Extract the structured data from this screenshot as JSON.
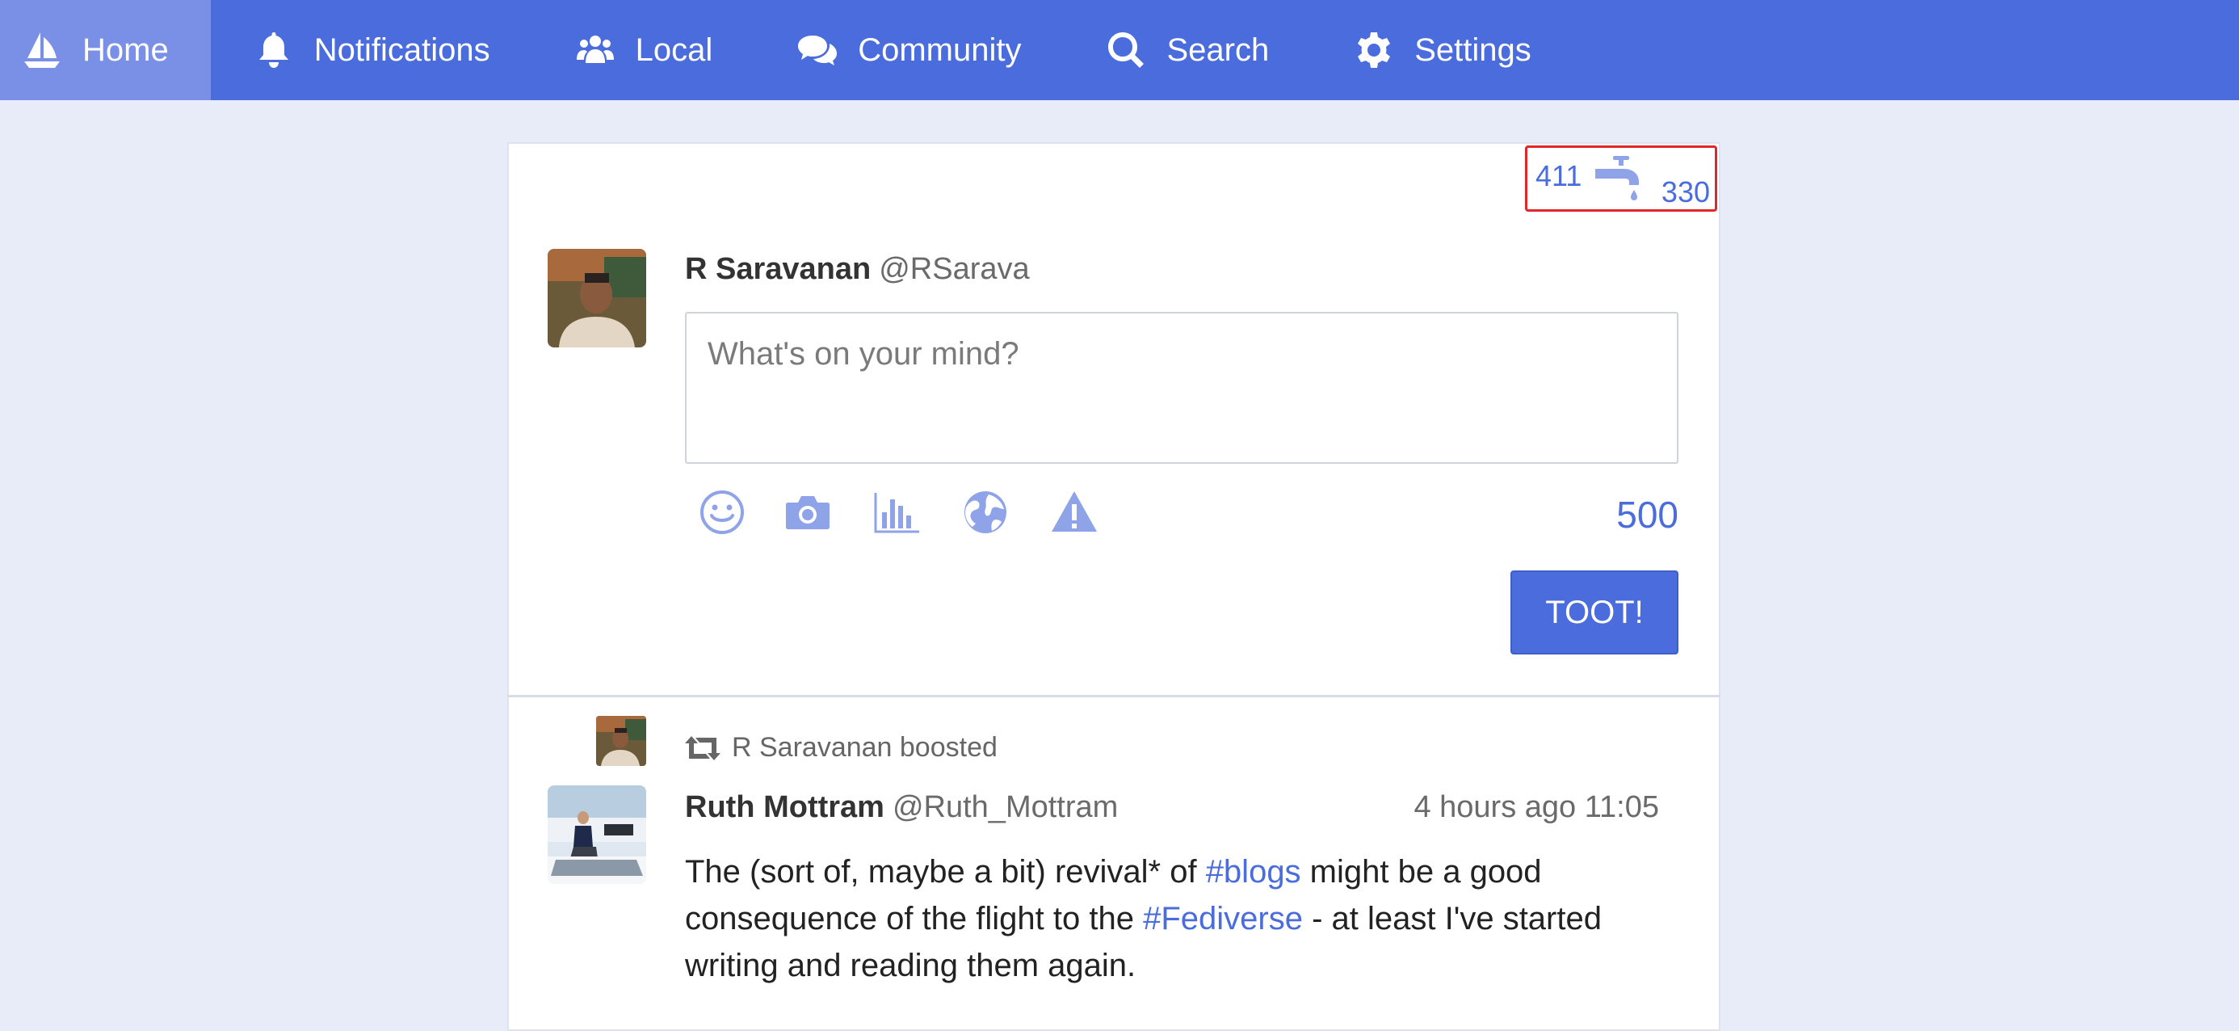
{
  "nav": {
    "items": [
      {
        "label": "Home",
        "icon": "sailboat-icon",
        "active": true
      },
      {
        "label": "Notifications",
        "icon": "bell-icon"
      },
      {
        "label": "Local",
        "icon": "users-icon"
      },
      {
        "label": "Community",
        "icon": "comments-icon"
      },
      {
        "label": "Search",
        "icon": "search-icon"
      },
      {
        "label": "Settings",
        "icon": "gear-icon"
      }
    ]
  },
  "counters": {
    "left": "411",
    "right": "330",
    "icon": "faucet-icon"
  },
  "composer": {
    "name": "R Saravanan",
    "handle": "@RSarava",
    "placeholder": "What's on your mind?",
    "char_count": "500",
    "submit_label": "TOOT!",
    "tools": [
      "smile-icon",
      "camera-icon",
      "poll-icon",
      "globe-icon",
      "warning-icon"
    ]
  },
  "status": {
    "boosted_by": "R Saravanan boosted",
    "author_name": "Ruth Mottram",
    "author_handle": "@Ruth_Mottram",
    "time": "4 hours ago 11:05",
    "body": {
      "part1": "The (sort of, maybe a bit) revival* of ",
      "tag1": "#blogs",
      "part2": " might be a good consequence of the flight to the ",
      "tag2": "#Fediverse",
      "part3": " - at least I've started writing and reading them again."
    }
  },
  "colors": {
    "accent": "#4a6cdc",
    "nav_active": "#7990e6",
    "background": "#e8ecf8",
    "icon_muted": "#8fa3e8",
    "highlight_border": "#e0282a"
  }
}
